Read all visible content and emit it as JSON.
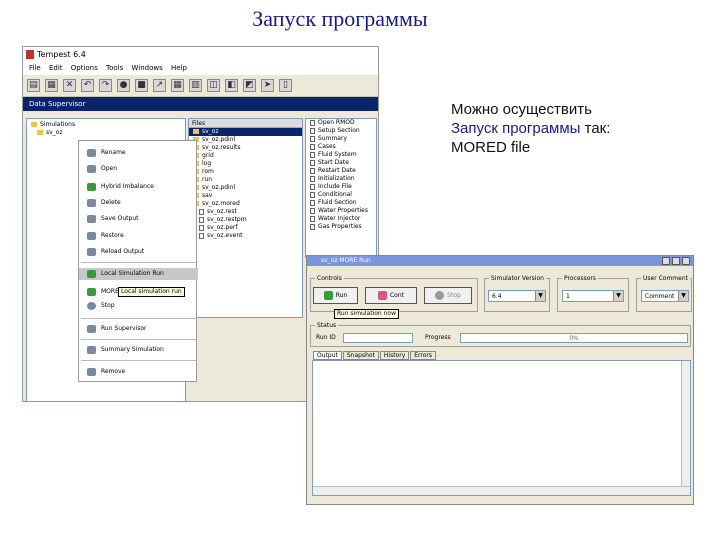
{
  "slide": {
    "title": "Запуск программы",
    "note_line1": "Можно осуществить",
    "note_line2_highlight": "Запуск программы",
    "note_line2_rest": " так:",
    "note_line3": "MORED file"
  },
  "app": {
    "title": "Tempest 6.4",
    "menu": [
      "File",
      "Edit",
      "Options",
      "Tools",
      "Windows",
      "Help"
    ],
    "subwindow_title": "Data Supervisor"
  },
  "left_pane": {
    "rows": [
      "Simulations",
      "sv_oz"
    ]
  },
  "files_pane": {
    "header": "Files",
    "rows": [
      "sv_oz",
      "sv_oz.pdinl",
      "sv_oz.results",
      "grid",
      "log",
      "rom",
      "run",
      "sv_oz.pdinl",
      "sav",
      "sv_oz.mored",
      "sv_oz.rest",
      "sv_oz.restpm",
      "sv_oz.perf",
      "sv_oz.event"
    ]
  },
  "sections_pane": {
    "rows": [
      "Open RMOD",
      "Setup Section",
      "Summary",
      "Cases",
      "Fluid System",
      "Start Date",
      "Restart Date",
      "Initialization",
      "Include File",
      "Conditional",
      "Fluid Section",
      "Water Properties",
      "Water Injector",
      "Gas Properties"
    ]
  },
  "context_menu": {
    "items": [
      "Rename",
      "Open",
      "Hybrid Imbalance",
      "Delete",
      "Save Output",
      "Restore",
      "Reload Output",
      "Local Simulation Run",
      "MORE",
      "Stop",
      "Run Supervisor",
      "Summary Simulation",
      "Remove"
    ],
    "tooltip": "Local simulation run"
  },
  "mored_window": {
    "title": "sv_oz MORE Run",
    "controls_label": "Controls",
    "run_label": "Run",
    "continue_label": "Cont",
    "stop_label": "Stop",
    "simulator_label": "Simulator Version",
    "simulator_value": "6.4",
    "processors_label": "Processors",
    "processors_value": "1",
    "user_comment_label": "User Comment",
    "user_comment_value": "Comment",
    "tooltip": "Run simulation now",
    "status_label": "Status",
    "run_id_label": "Run ID",
    "progress_label": "Progress",
    "progress_value": "0%",
    "tabs": [
      "Output",
      "Snapshot",
      "History",
      "Errors"
    ]
  }
}
